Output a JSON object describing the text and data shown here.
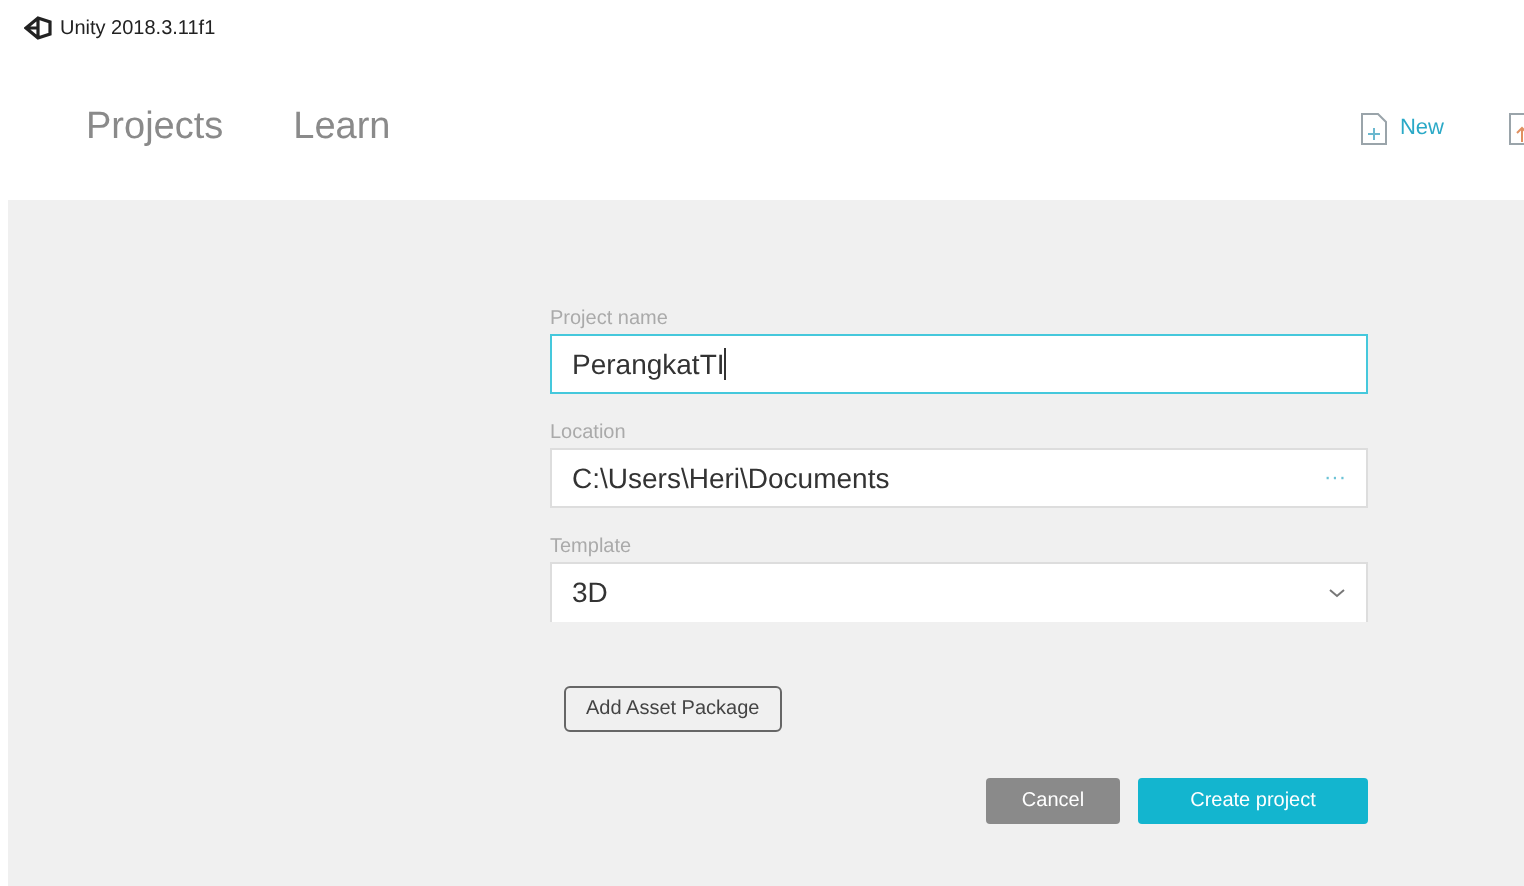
{
  "window": {
    "title": "Unity 2018.3.11f1"
  },
  "tabs": [
    {
      "label": "Projects",
      "selected": false
    },
    {
      "label": "Learn",
      "selected": false
    }
  ],
  "toolbar": [
    {
      "kind": "new",
      "label": "New"
    },
    {
      "kind": "open"
    }
  ],
  "form": {
    "project_name": {
      "label": "Project name",
      "value": "PerangkatTI",
      "focused": true
    },
    "location": {
      "label": "Location",
      "value": "C:\\Users\\Heri\\Documents",
      "browse": "···"
    },
    "template": {
      "label": "Template",
      "value": "3D"
    },
    "add_asset_package": "Add Asset Package",
    "cancel": "Cancel",
    "create": "Create project"
  }
}
